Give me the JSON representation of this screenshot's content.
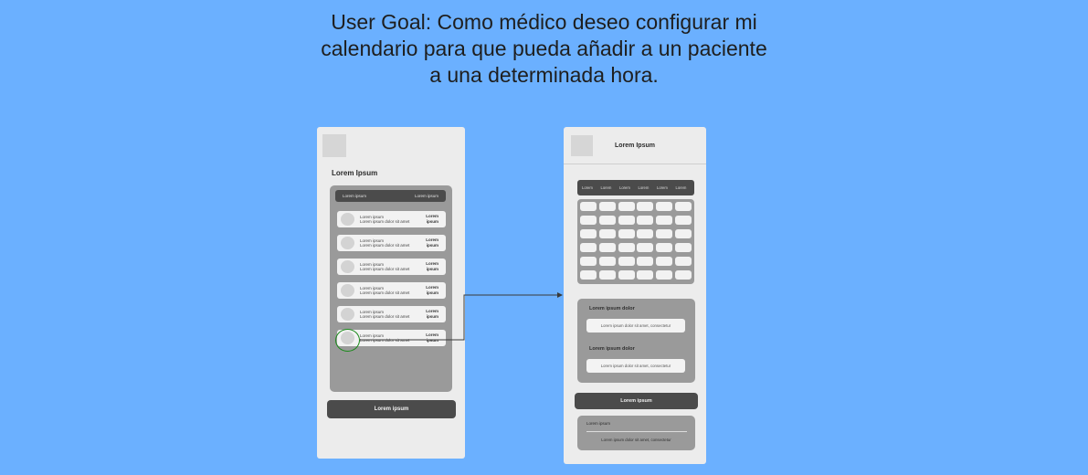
{
  "goal": {
    "line1": "User Goal: Como médico deseo configurar mi",
    "line2": "calendario para que pueda añadir a un paciente",
    "line3": "a una determinada hora."
  },
  "screen1": {
    "title": "Lorem Ipsum",
    "header_left": "Lorem ipsum",
    "header_right": "Lorem ipsum",
    "rows": [
      {
        "line1": "Lorem ipsum",
        "line2": "Lorem ipsum dolor sit amet",
        "right1": "Lorem",
        "right2": "ipsum"
      },
      {
        "line1": "Lorem ipsum",
        "line2": "Lorem ipsum dolor sit amet",
        "right1": "Lorem",
        "right2": "ipsum"
      },
      {
        "line1": "Lorem ipsum",
        "line2": "Lorem ipsum dolor sit amet",
        "right1": "Lorem",
        "right2": "ipsum"
      },
      {
        "line1": "Lorem ipsum",
        "line2": "Lorem ipsum dolor sit amet",
        "right1": "Lorem",
        "right2": "ipsum"
      },
      {
        "line1": "Lorem ipsum",
        "line2": "Lorem ipsum dolor sit amet",
        "right1": "Lorem",
        "right2": "ipsum"
      },
      {
        "line1": "Lorem ipsum",
        "line2": "Lorem ipsum dolor sit amet",
        "right1": "Lorem",
        "right2": "ipsum"
      }
    ],
    "button": "Lorem ipsum"
  },
  "screen2": {
    "title": "Lorem Ipsum",
    "days": [
      "Lorem",
      "Lorem",
      "Lorem",
      "Lorem",
      "Lorem",
      "Lorem"
    ],
    "form_label_1": "Lorem ipsum dolor",
    "form_field_1": "Lorem ipsum dolor sit amet, consectetur",
    "form_label_2": "Lorem ipsum dolor",
    "form_field_2": "Lorem ipsum dolor sit amet, consectetur",
    "button": "Lorem ipsum",
    "note_label": "Lorem ipsum",
    "note_text": "Lorem ipsum dolor sit amet, consectetur"
  },
  "colors": {
    "background": "#6bb0ff",
    "screen": "#ececec",
    "dark": "#4b4b4b",
    "panel": "#9a9a9a",
    "hotspot": "#1c8a1c"
  }
}
